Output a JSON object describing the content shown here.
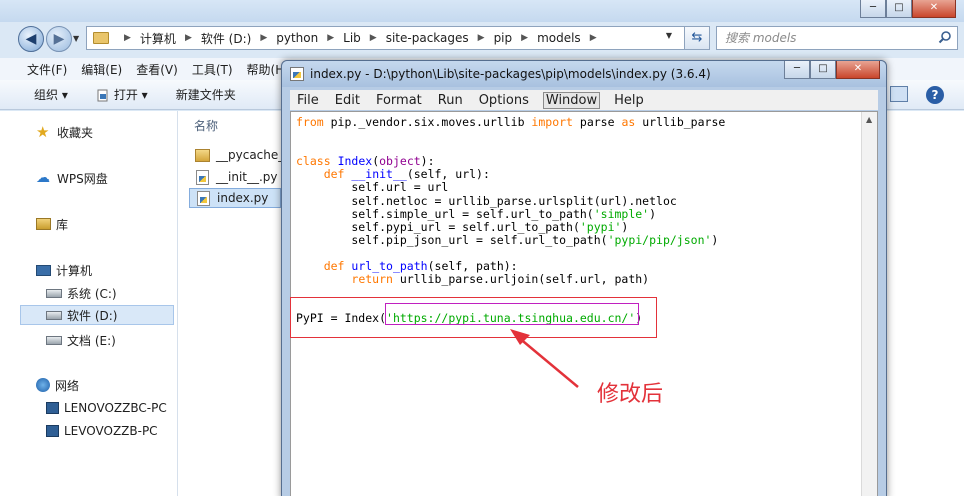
{
  "explorer": {
    "caption_buttons": [
      "─",
      "□",
      "✕"
    ],
    "breadcrumb": [
      "计算机",
      "软件 (D:)",
      "python",
      "Lib",
      "site-packages",
      "pip",
      "models"
    ],
    "search_placeholder": "搜索 models",
    "menu": [
      "文件(F)",
      "编辑(E)",
      "查看(V)",
      "工具(T)",
      "帮助(H)"
    ],
    "toolbar": [
      "组织 ▾",
      "打开 ▾",
      "新建文件夹"
    ],
    "nav": {
      "favorites": "收藏夹",
      "wps": "WPS网盘",
      "library": "库",
      "computer": "计算机",
      "drives": [
        "系统 (C:)",
        "软件 (D:)",
        "文档 (E:)"
      ],
      "network": "网络",
      "network_pcs": [
        "LENOVOZZBC-PC",
        "LEVOVOZZB-PC"
      ]
    },
    "column_name": "名称",
    "files": [
      "__pycache__",
      "__init__.py",
      "index.py"
    ]
  },
  "idle": {
    "title": "index.py - D:\\python\\Lib\\site-packages\\pip\\models\\index.py (3.6.4)",
    "caption_buttons": [
      "─",
      "□",
      "✕"
    ],
    "menu": [
      "File",
      "Edit",
      "Format",
      "Run",
      "Options",
      "Window",
      "Help"
    ],
    "active_menu": "Window"
  },
  "annotation": {
    "label": "修改后",
    "color": "#e3323a"
  },
  "syntax_colors": {
    "keyword": "#ff7700",
    "builtin": "#900090",
    "definition": "#0000ff",
    "string": "#00aa00"
  }
}
